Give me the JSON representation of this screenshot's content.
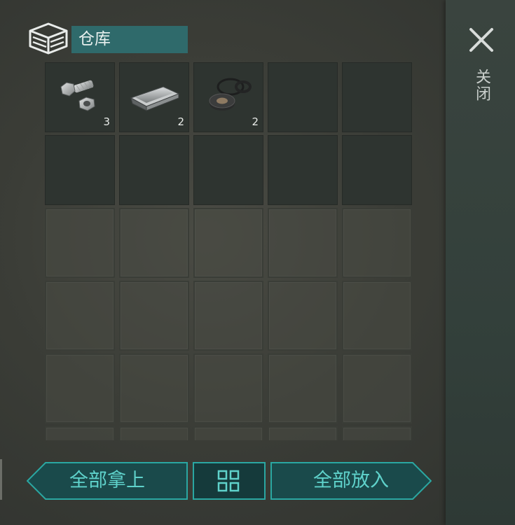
{
  "header": {
    "title": "仓库",
    "storage_icon": "storage-box-icon"
  },
  "close": {
    "icon": "close-icon",
    "label": "关闭"
  },
  "grid": {
    "columns": 5,
    "unlocked_rows": 2,
    "locked_rows": 3,
    "items": [
      {
        "name": "bolts-and-nuts",
        "icon": "bolt-nut-icon",
        "qty": "3"
      },
      {
        "name": "metal-ingot",
        "icon": "metal-ingot-icon",
        "qty": "2"
      },
      {
        "name": "rubber-seals",
        "icon": "rubber-seal-icon",
        "qty": "2"
      }
    ]
  },
  "actions": {
    "take_all": "全部拿上",
    "sort_icon": "sort-grid-icon",
    "put_all": "全部放入"
  },
  "colors": {
    "accent": "#2aa7a2",
    "accent_text": "#5fd2cb",
    "title_bg": "#2f6a6b"
  }
}
